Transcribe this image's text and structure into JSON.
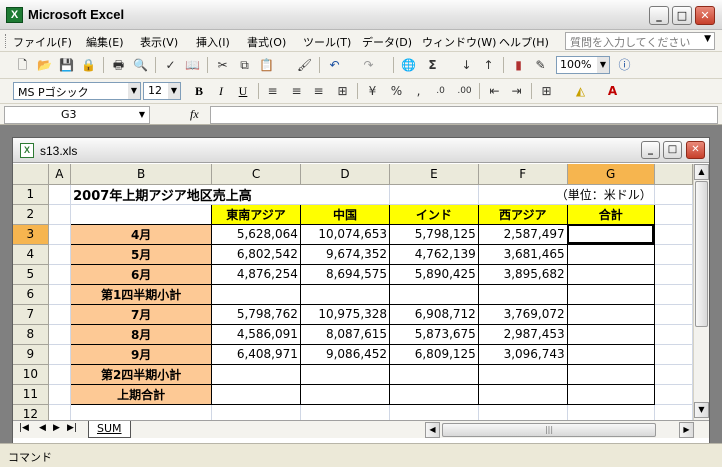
{
  "window": {
    "title": "Microsoft Excel"
  },
  "menu": {
    "items": [
      "ファイル(F)",
      "編集(E)",
      "表示(V)",
      "挿入(I)",
      "書式(O)",
      "ツール(T)",
      "データ(D)",
      "ウィンドウ(W)",
      "ヘルプ(H)"
    ],
    "help_placeholder": "質問を入力してください"
  },
  "toolbar": {
    "zoom": "100%",
    "font_name": "MS Pゴシック",
    "font_size": "12"
  },
  "formula_bar": {
    "name_box": "G3",
    "fx": "fx",
    "content": ""
  },
  "workbook": {
    "title": "s13.xls",
    "sheet_tab": "SUM",
    "columns": [
      "A",
      "B",
      "C",
      "D",
      "E",
      "F",
      "G"
    ],
    "rows": [
      "1",
      "2",
      "3",
      "4",
      "5",
      "6",
      "7",
      "8",
      "9",
      "10",
      "11",
      "12"
    ],
    "active_column": "G",
    "active_row": "3",
    "title_text": "2007年上期アジア地区売上高",
    "unit_text": "（単位：米ドル）",
    "headers": [
      "東南アジア",
      "中国",
      "インド",
      "西アジア",
      "合計"
    ],
    "data_rows": [
      {
        "label": "4月",
        "values": [
          "5,628,064",
          "10,074,653",
          "5,798,125",
          "2,587,497",
          ""
        ]
      },
      {
        "label": "5月",
        "values": [
          "6,802,542",
          "9,674,352",
          "4,762,139",
          "3,681,465",
          ""
        ]
      },
      {
        "label": "6月",
        "values": [
          "4,876,254",
          "8,694,575",
          "5,890,425",
          "3,895,682",
          ""
        ]
      },
      {
        "label": "第1四半期小計",
        "values": [
          "",
          "",
          "",
          "",
          ""
        ]
      },
      {
        "label": "7月",
        "values": [
          "5,798,762",
          "10,975,328",
          "6,908,712",
          "3,769,072",
          ""
        ]
      },
      {
        "label": "8月",
        "values": [
          "4,586,091",
          "8,087,615",
          "5,873,675",
          "2,987,453",
          ""
        ]
      },
      {
        "label": "9月",
        "values": [
          "6,408,971",
          "9,086,452",
          "6,809,125",
          "3,096,743",
          ""
        ]
      },
      {
        "label": "第2四半期小計",
        "values": [
          "",
          "",
          "",
          "",
          ""
        ]
      },
      {
        "label": "上期合計",
        "values": [
          "",
          "",
          "",
          "",
          ""
        ]
      }
    ]
  },
  "status": {
    "text": "コマンド"
  }
}
